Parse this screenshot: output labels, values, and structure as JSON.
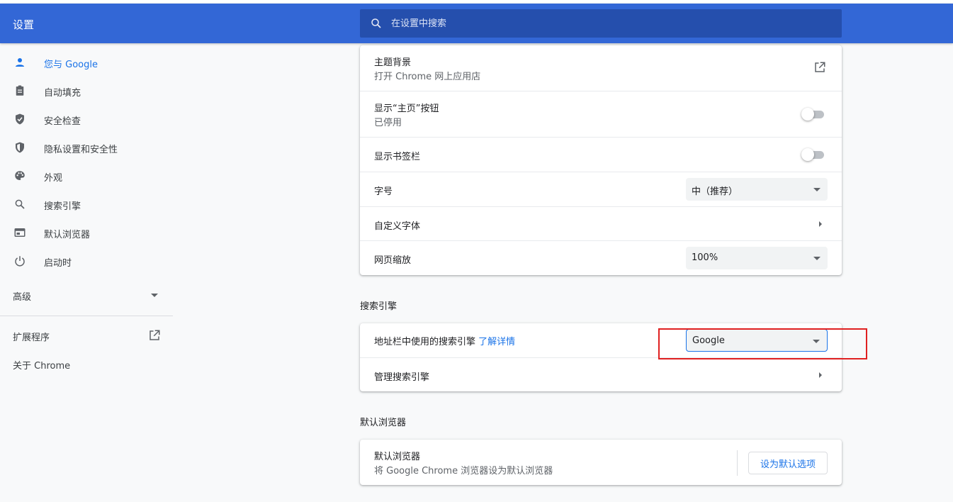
{
  "header": {
    "title": "设置",
    "search_placeholder": "在设置中搜索"
  },
  "sidebar": {
    "items": [
      {
        "label": "您与 Google",
        "icon": "person-icon",
        "active": true
      },
      {
        "label": "自动填充",
        "icon": "clipboard-icon"
      },
      {
        "label": "安全检查",
        "icon": "shield-check-icon"
      },
      {
        "label": "隐私设置和安全性",
        "icon": "shield-icon"
      },
      {
        "label": "外观",
        "icon": "palette-icon"
      },
      {
        "label": "搜索引擎",
        "icon": "search-icon"
      },
      {
        "label": "默认浏览器",
        "icon": "browser-icon"
      },
      {
        "label": "启动时",
        "icon": "power-icon"
      }
    ],
    "advanced_label": "高级",
    "extensions_label": "扩展程序",
    "about_label": "关于 Chrome"
  },
  "appearance": {
    "theme_title": "主题背景",
    "theme_sub": "打开 Chrome 网上应用店",
    "home_button_title": "显示“主页”按钮",
    "home_button_sub": "已停用",
    "bookmarks_bar_title": "显示书签栏",
    "font_size_title": "字号",
    "font_size_value": "中（推荐）",
    "custom_fonts_title": "自定义字体",
    "zoom_title": "网页缩放",
    "zoom_value": "100%"
  },
  "search_engine": {
    "section_title": "搜索引擎",
    "address_bar_label": "地址栏中使用的搜索引擎",
    "learn_more": "了解详情",
    "engine_value": "Google",
    "manage_label": "管理搜索引擎"
  },
  "default_browser": {
    "section_title": "默认浏览器",
    "title": "默认浏览器",
    "sub": "将 Google Chrome 浏览器设为默认浏览器",
    "button_label": "设为默认选项"
  },
  "colors": {
    "header": "#3367d6",
    "accent": "#1a73e8",
    "highlight": "#e02020"
  }
}
